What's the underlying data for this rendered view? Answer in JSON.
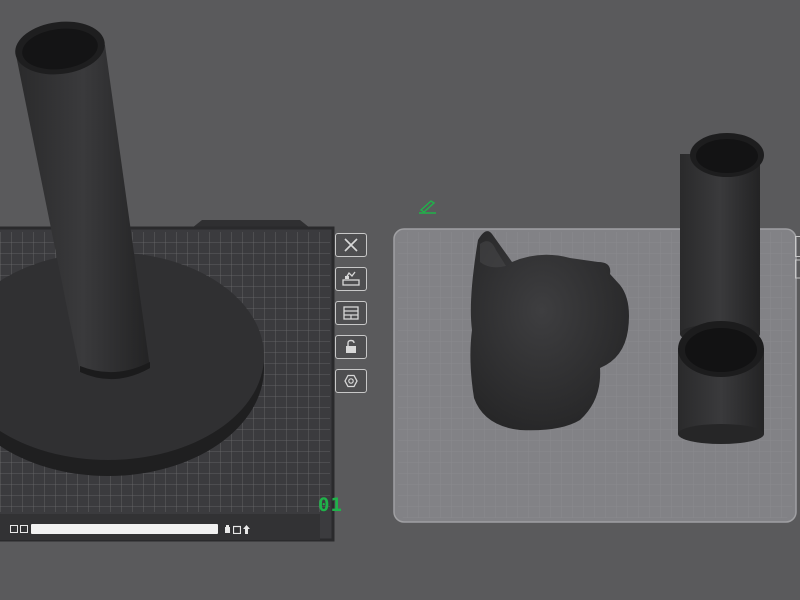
{
  "app": {
    "accent_color": "#1fb34a",
    "background_color": "#5a5a5c"
  },
  "plate_1": {
    "index_label": "01",
    "toolbar": [
      {
        "name": "remove-plate-button",
        "icon": "close-icon"
      },
      {
        "name": "auto-arrange-button",
        "icon": "arrange-icon"
      },
      {
        "name": "plate-settings-button",
        "icon": "layout-icon"
      },
      {
        "name": "lock-plate-button",
        "icon": "unlock-icon"
      },
      {
        "name": "slice-plate-button",
        "icon": "hexagon-icon"
      }
    ],
    "name_bar": {
      "left_icons": [
        "plate-icon",
        "filament-icon"
      ],
      "right_icons": [
        "weight-icon",
        "square-icon",
        "upload-icon"
      ]
    }
  },
  "plate_2": {
    "edit_icon": "pencil-icon"
  }
}
